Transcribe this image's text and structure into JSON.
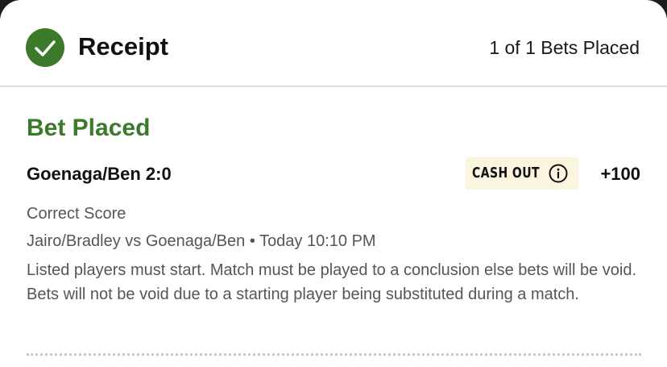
{
  "header": {
    "title": "Receipt",
    "bets_count": "1 of 1 Bets Placed",
    "status_icon": "checkmark-icon",
    "accent_color": "#3b7a2b"
  },
  "bet": {
    "status": "Bet Placed",
    "selection": "Goenaga/Ben 2:0",
    "cashout_label": "CASH OUT",
    "cashout_icon": "info-icon",
    "odds": "+100",
    "market": "Correct Score",
    "event": {
      "teams": "Jairo/Bradley vs Goenaga/Ben",
      "separator": "•",
      "time": "Today 10:10 PM"
    },
    "rules": "Listed players must start. Match must be played to a conclusion else bets will be void. Bets will not be void due to a starting player being substituted during a match."
  }
}
